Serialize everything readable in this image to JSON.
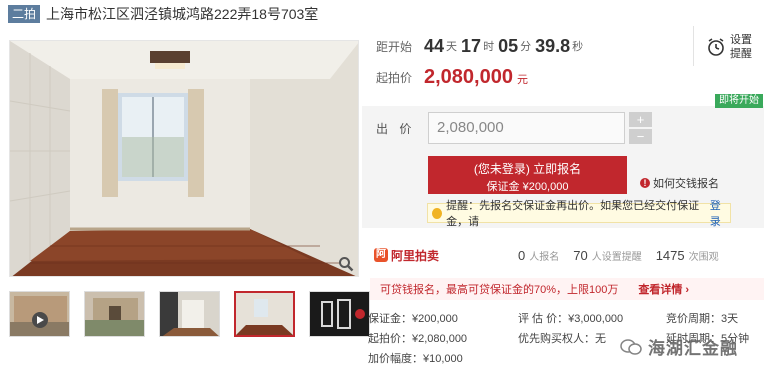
{
  "header": {
    "badge": "二拍",
    "title": "上海市松江区泗泾镇城鸿路222弄18号703室"
  },
  "gallery": {
    "zoom_icon": "magnifier-icon",
    "thumbnails": [
      {
        "name": "building-exterior",
        "active": false
      },
      {
        "name": "building-entrance",
        "active": false
      },
      {
        "name": "interior-hallway",
        "active": false
      },
      {
        "name": "interior-room",
        "active": true
      },
      {
        "name": "certificate-image",
        "active": false
      }
    ]
  },
  "countdown": {
    "label": "距开始",
    "days": "44",
    "days_unit": "天",
    "hours": "17",
    "hours_unit": "时",
    "minutes": "05",
    "minutes_unit": "分",
    "seconds": "39.8",
    "seconds_unit": "秒"
  },
  "remind": {
    "icon": "alarm-clock-icon",
    "line1": "设置",
    "line2": "提醒"
  },
  "start_price": {
    "label": "起拍价",
    "value": "2,080,000",
    "unit": "元"
  },
  "status_tag": "即将开始",
  "bid": {
    "label": "出 价",
    "input_value": "2,080,000",
    "plus": "+",
    "minus": "−"
  },
  "signup_button": {
    "main": "(您未登录) 立即报名",
    "sub": "保证金 ¥200,000"
  },
  "how_to": {
    "icon": "!",
    "text": "如何交钱报名"
  },
  "tip": {
    "text": "提醒：先报名交保证金再出价。如果您已经交付保证金，请",
    "link": "登录"
  },
  "stats": {
    "logo_mark": "阿",
    "logo_text": "阿里拍卖",
    "signups": "0",
    "signups_label": "人报名",
    "reminders": "70",
    "reminders_label": "人设置提醒",
    "views": "1475",
    "views_label": "次围观"
  },
  "promo": {
    "text": "可贷钱报名，最高可贷保证金的70%，上限100万",
    "link": "查看详情 ›"
  },
  "info": {
    "deposit": "保证金：¥200,000",
    "appraisal": "评 估 价：¥3,000,000",
    "cycle": "竞价周期：3天",
    "start": "起拍价：¥2,080,000",
    "priority": "优先购买权人：无",
    "delay": "延时周期：5分钟",
    "increment": "加价幅度：¥10,000"
  },
  "watermark": "海湖汇金融",
  "colors": {
    "accent_red": "#c1272d",
    "badge_blue": "#5d7d9e",
    "status_green": "#3aa95b",
    "link_blue": "#1b5fb4"
  }
}
